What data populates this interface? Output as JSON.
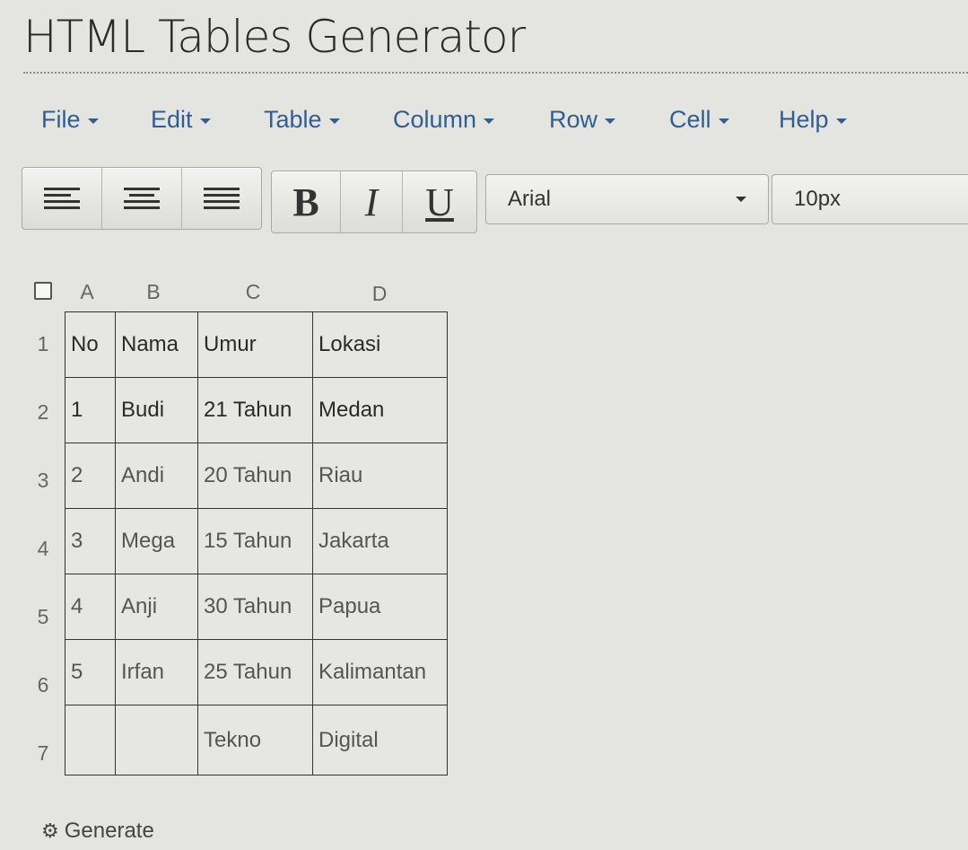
{
  "app": {
    "title": "HTML Tables Generator"
  },
  "menu": [
    {
      "label": "File"
    },
    {
      "label": "Edit"
    },
    {
      "label": "Table"
    },
    {
      "label": "Column"
    },
    {
      "label": "Row"
    },
    {
      "label": "Cell"
    },
    {
      "label": "Help"
    }
  ],
  "toolbar": {
    "bold_label": "B",
    "italic_label": "I",
    "underline_label": "U",
    "font_family": "Arial",
    "font_size": "10px"
  },
  "grid": {
    "columns": [
      "A",
      "B",
      "C",
      "D"
    ],
    "rows": [
      {
        "num": "1",
        "cells": [
          "No",
          "Nama",
          "Umur",
          "Lokasi"
        ]
      },
      {
        "num": "2",
        "cells": [
          "1",
          "Budi",
          "21 Tahun",
          "Medan"
        ]
      },
      {
        "num": "3",
        "cells": [
          "2",
          "Andi",
          "20 Tahun",
          "Riau"
        ]
      },
      {
        "num": "4",
        "cells": [
          "3",
          "Mega",
          "15 Tahun",
          "Jakarta"
        ]
      },
      {
        "num": "5",
        "cells": [
          "4",
          "Anji",
          "30 Tahun",
          "Papua"
        ]
      },
      {
        "num": "6",
        "cells": [
          "5",
          "Irfan",
          "25 Tahun",
          "Kalimantan"
        ]
      },
      {
        "num": "7",
        "cells": [
          "",
          "",
          "Tekno",
          "Digital"
        ]
      }
    ]
  },
  "actions": {
    "generate_label": "Generate"
  }
}
